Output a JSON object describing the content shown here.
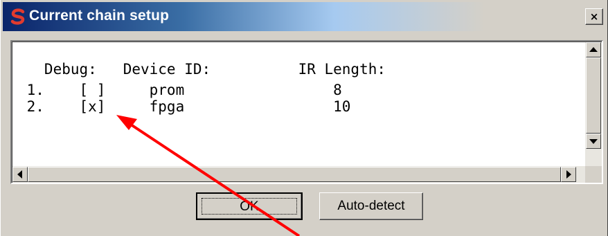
{
  "window": {
    "title": "Current chain setup",
    "close_glyph": "×",
    "app_icon": "s-logo-icon"
  },
  "text_area": {
    "header": "   Debug:   Device ID:          IR Length:",
    "rows": [
      " 1.    [ ]     prom                 8",
      " 2.    [x]     fpga                 10"
    ]
  },
  "buttons": {
    "ok_label": "OK",
    "auto_detect_label": "Auto-detect"
  },
  "annotation": {
    "color": "#ff0000"
  }
}
